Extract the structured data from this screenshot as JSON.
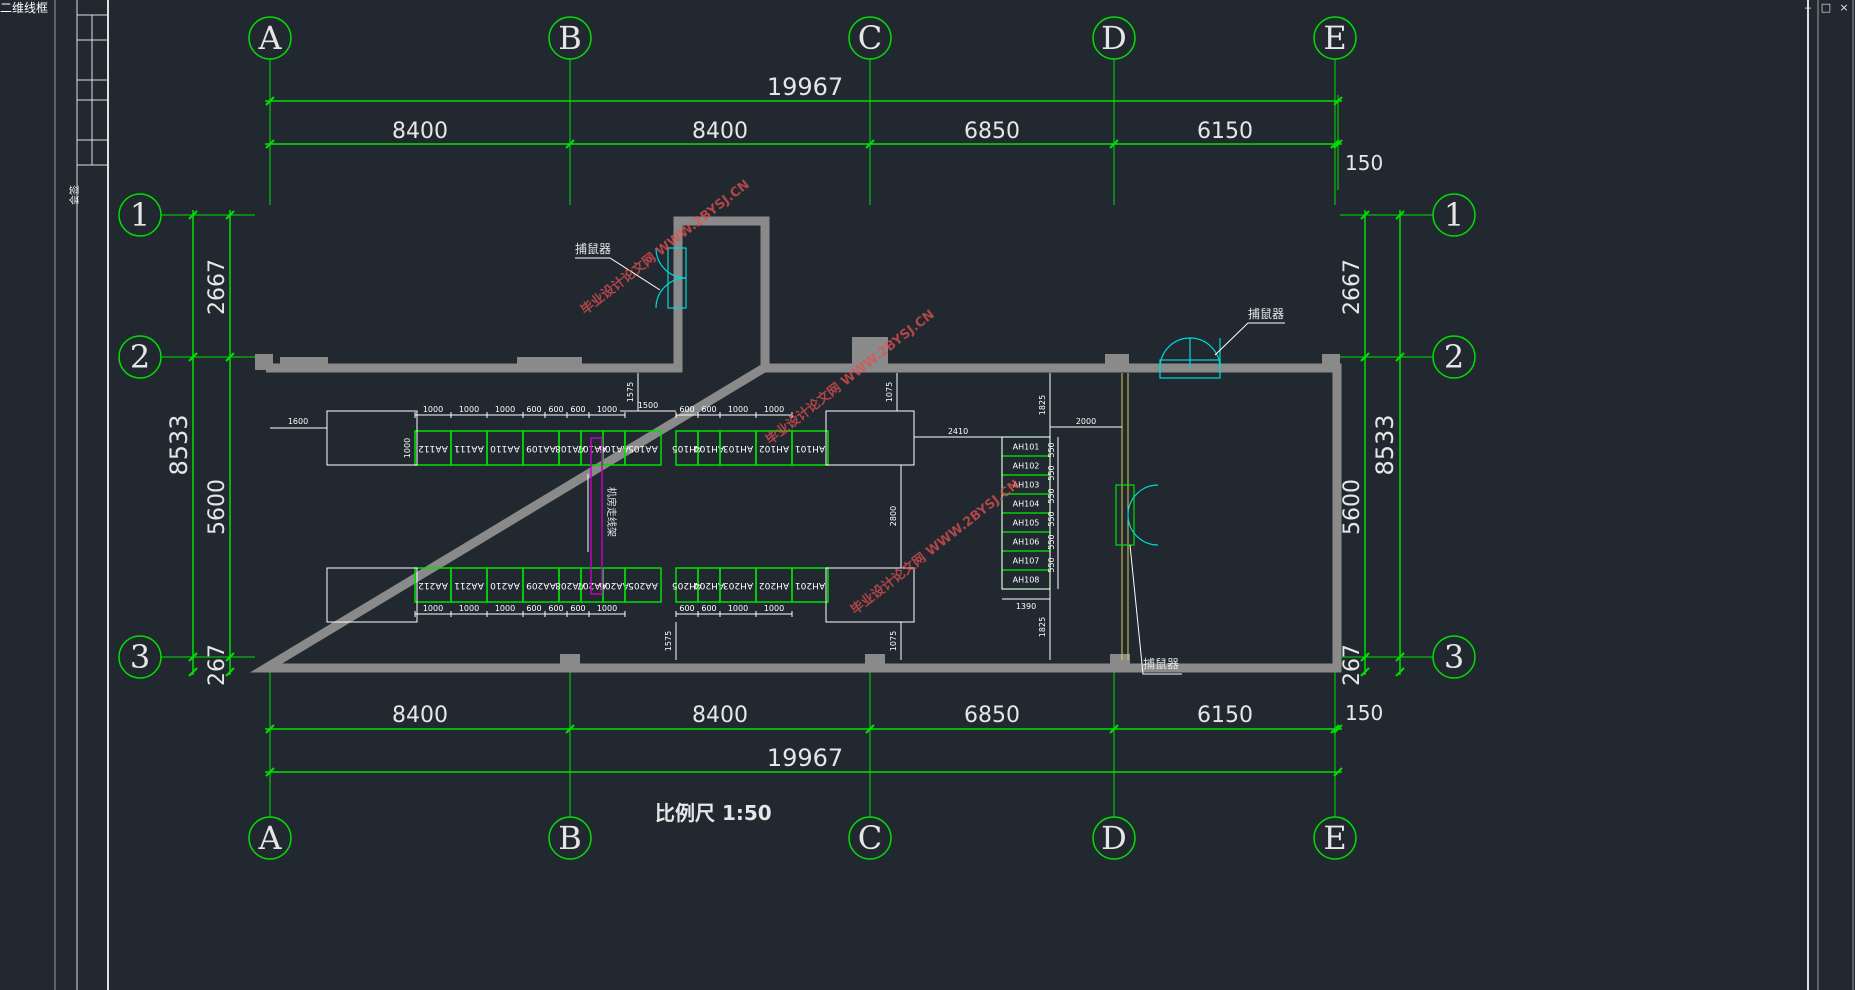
{
  "tab": {
    "title": "二维线框"
  },
  "window": {
    "minimize": "‒",
    "restore": "□",
    "close": "×"
  },
  "title_block": {
    "label": "会签"
  },
  "axes": {
    "columns": [
      "A",
      "B",
      "C",
      "D",
      "E"
    ],
    "rows": [
      "1",
      "2",
      "3"
    ]
  },
  "dimensions": {
    "overall_width": "19967",
    "bays": [
      "8400",
      "8400",
      "6850",
      "6150"
    ],
    "edge_offset": "150",
    "overall_depth": "8533",
    "row_spans": [
      "2667",
      "5600",
      "267"
    ]
  },
  "labels": {
    "mouse_trap": "捕鼠器",
    "scale": "比例尺 1:50"
  },
  "internal_dims": {
    "top_left": [
      "1000",
      "1000",
      "1000",
      "600",
      "600",
      "600",
      "1000"
    ],
    "bottom_left": [
      "1000",
      "1000",
      "1000",
      "600",
      "600",
      "600",
      "1000"
    ],
    "top_right": [
      "600",
      "600",
      "1000",
      "1000"
    ],
    "bottom_right": [
      "600",
      "600",
      "1000",
      "1000"
    ],
    "clear_1600": "1600",
    "clear_1575": "1575",
    "clear_1500": "1500",
    "clear_1075": "1075",
    "clear_2410": "2410",
    "clear_2000": "2000",
    "clear_1825": "1825",
    "clear_2800": "2800",
    "clear_1390": "1390",
    "cab_depth": "1000",
    "cell_550": "550"
  },
  "racks": {
    "row1_left": [
      "AA112",
      "AA111",
      "AA110",
      "AA109",
      "AA108",
      "AA107",
      "AA106",
      "AA105"
    ],
    "row2_left": [
      "AA212",
      "AA211",
      "AA210",
      "AA209",
      "AA208",
      "AA207",
      "AA206",
      "AA205"
    ],
    "row1_right": [
      "AH105",
      "AH104",
      "AH103",
      "AH102",
      "AH101"
    ],
    "row2_right": [
      "AH205",
      "AH204",
      "AH203",
      "AH202",
      "AH201"
    ],
    "column": [
      "AH101",
      "AH102",
      "AH103",
      "AH104",
      "AH105",
      "AH106",
      "AH107",
      "AH108"
    ]
  },
  "annotations": {
    "trough": "机房走线架",
    "watermark": "毕业设计论文网 WWW.2BYSJ.CN"
  },
  "colors": {
    "background": "#212830",
    "axis_green": "#00e000",
    "wall_gray": "#8a8a8a",
    "door_cyan": "#00d8d8",
    "highlight_magenta": "#c000c0",
    "watermark_red": "#e05050"
  }
}
